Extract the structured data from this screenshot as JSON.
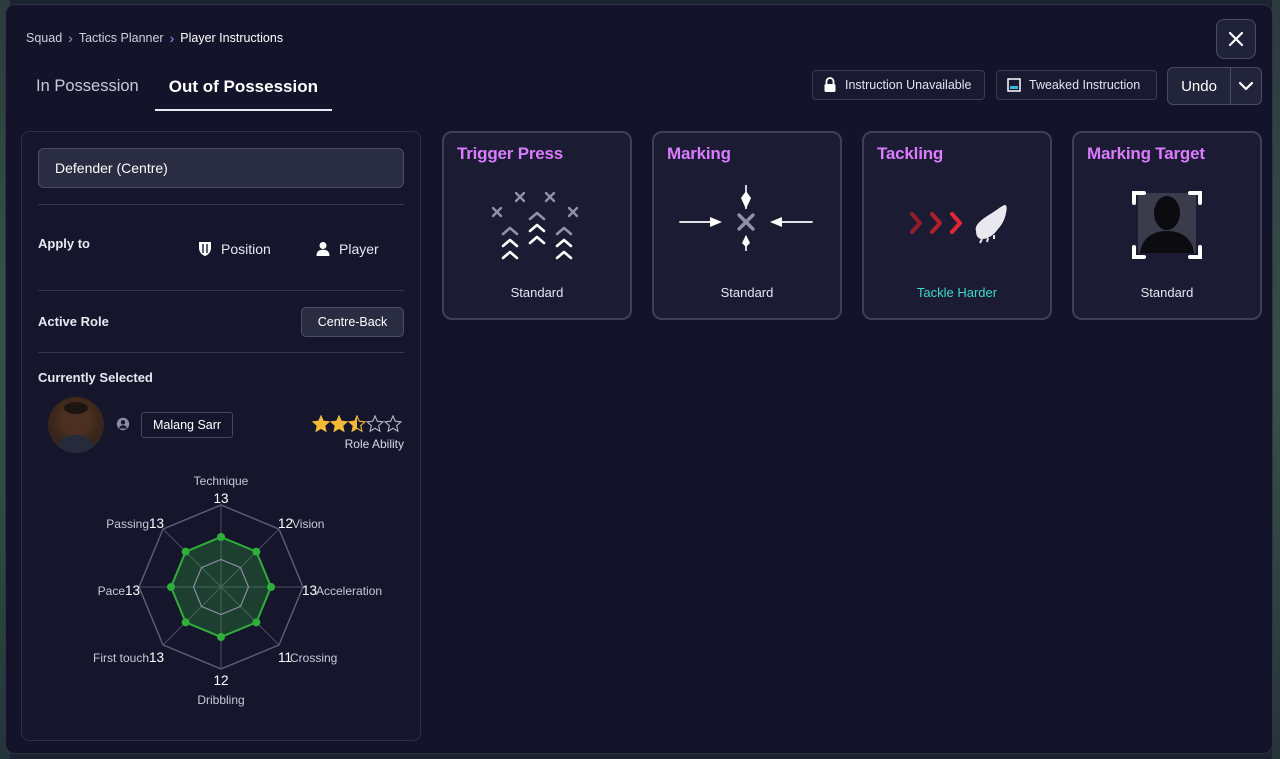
{
  "breadcrumb": [
    "Squad",
    "Tactics Planner",
    "Player Instructions"
  ],
  "tabs": [
    {
      "label": "In Possession",
      "active": false
    },
    {
      "label": "Out of Possession",
      "active": true
    }
  ],
  "legend": {
    "unavailable": "Instruction Unavailable",
    "tweaked": "Tweaked Instruction"
  },
  "undo_label": "Undo",
  "left": {
    "position": "Defender (Centre)",
    "apply_to_label": "Apply to",
    "apply_position": "Position",
    "apply_player": "Player",
    "active_role_label": "Active Role",
    "active_role": "Centre-Back",
    "currently_selected_label": "Currently Selected",
    "player_name": "Malang Sarr",
    "role_ability_label": "Role Ability",
    "role_ability_stars": 2.5,
    "role_ability_max": 5,
    "attributes": [
      {
        "name": "Technique",
        "value": "13"
      },
      {
        "name": "Vision",
        "value": "12"
      },
      {
        "name": "Acceleration",
        "value": "13"
      },
      {
        "name": "Crossing",
        "value": "11"
      },
      {
        "name": "Dribbling",
        "value": "12"
      },
      {
        "name": "First touch",
        "value": "13"
      },
      {
        "name": "Pace",
        "value": "13"
      },
      {
        "name": "Passing",
        "value": "13"
      }
    ]
  },
  "cards": [
    {
      "title": "Trigger Press",
      "value": "Standard",
      "highlight": false
    },
    {
      "title": "Marking",
      "value": "Standard",
      "highlight": false
    },
    {
      "title": "Tackling",
      "value": "Tackle Harder",
      "highlight": true
    },
    {
      "title": "Marking Target",
      "value": "Standard",
      "highlight": false
    }
  ],
  "colors": {
    "accent_title": "#d97cff",
    "highlight_value": "#3fd8cf",
    "radar_fill": "#2fae3a",
    "star": "#f5b93a",
    "tackle_arrows": "#c3202c"
  }
}
